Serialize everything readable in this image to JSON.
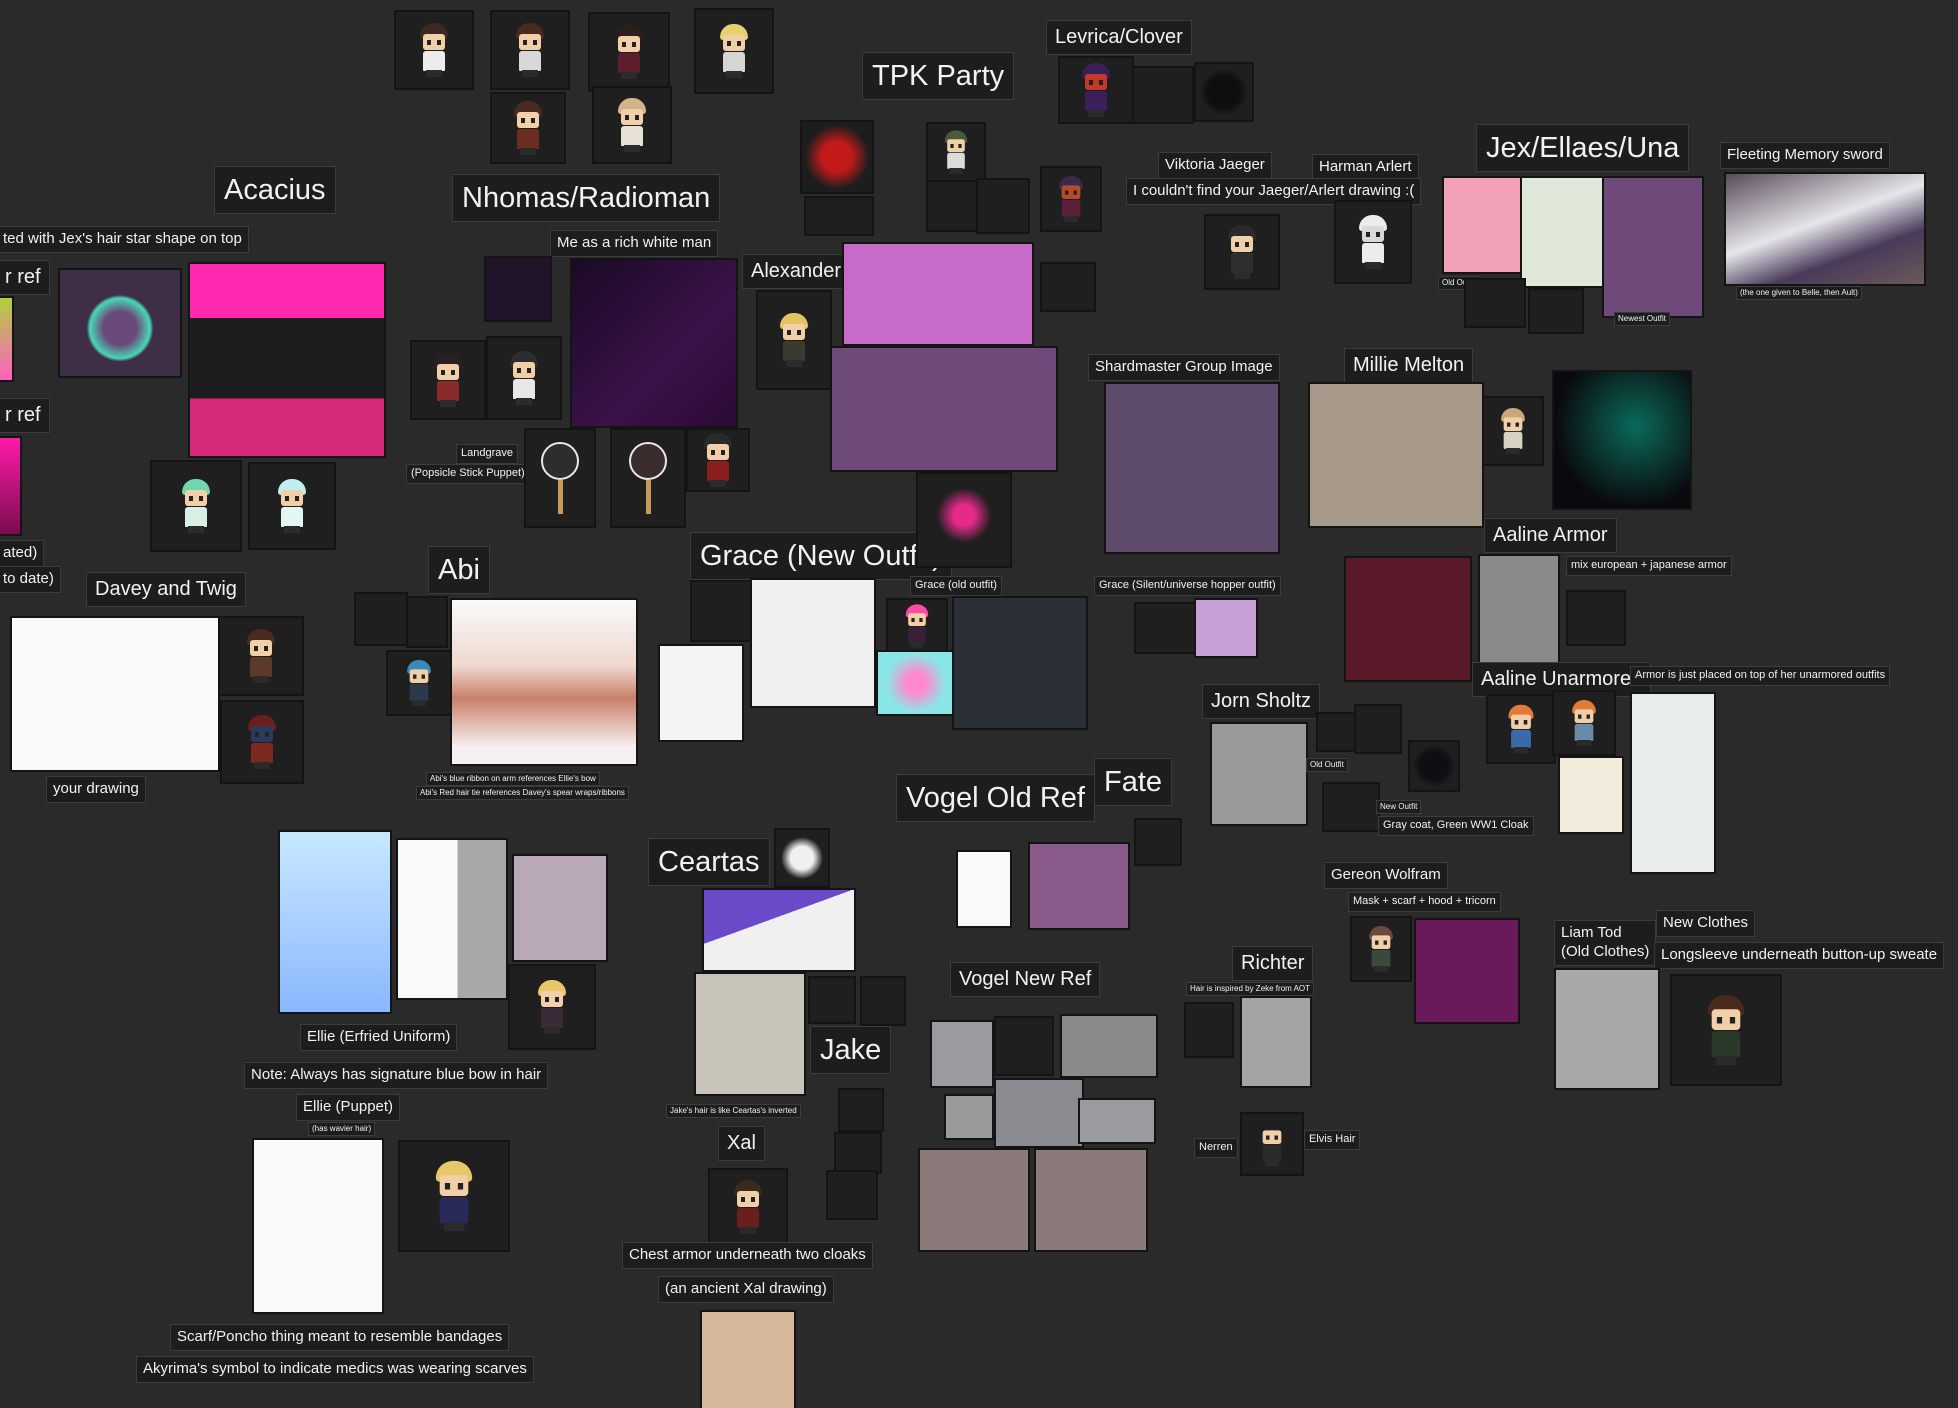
{
  "labels": [
    {
      "id": "acacius-title",
      "text": "Acacius"
    },
    {
      "id": "jex-hair-note",
      "text": "ted with Jex's hair star shape on top"
    },
    {
      "id": "ref-left-1",
      "text": "r ref"
    },
    {
      "id": "ref-left-2",
      "text": "r ref"
    },
    {
      "id": "ated-note",
      "text": "ated)"
    },
    {
      "id": "to-date-note",
      "text": "to date)"
    },
    {
      "id": "nhomas-title",
      "text": "Nhomas/Radioman"
    },
    {
      "id": "rich-white-man-note",
      "text": "Me as a rich white man"
    },
    {
      "id": "landgrave-note",
      "text": "Landgrave"
    },
    {
      "id": "popsicle-note",
      "text": "(Popsicle Stick Puppet)"
    },
    {
      "id": "tpk-title",
      "text": "TPK Party"
    },
    {
      "id": "levrica-title",
      "text": "Levrica/Clover"
    },
    {
      "id": "alexander-title",
      "text": "Alexander"
    },
    {
      "id": "viktoria-title",
      "text": "Viktoria Jaeger"
    },
    {
      "id": "harman-title",
      "text": "Harman Arlert"
    },
    {
      "id": "jaeger-arlert-note",
      "text": "I couldn't find your Jaeger/Arlert drawing :("
    },
    {
      "id": "jex-title",
      "text": "Jex/Ellaes/Una"
    },
    {
      "id": "jex-old-outfit",
      "text": "Old Outfit"
    },
    {
      "id": "jex-newest-outfit",
      "text": "Newest Outfit"
    },
    {
      "id": "fleeting-title",
      "text": "Fleeting Memory sword"
    },
    {
      "id": "fleeting-note",
      "text": "(the one given to Belle, then Ault)"
    },
    {
      "id": "shardmaster-title",
      "text": "Shardmaster Group Image"
    },
    {
      "id": "millie-title",
      "text": "Millie Melton"
    },
    {
      "id": "aaline-armor-title",
      "text": "Aaline Armor"
    },
    {
      "id": "aaline-armor-note",
      "text": "mix european + japanese armor"
    },
    {
      "id": "aaline-unarmored-title",
      "text": "Aaline Unarmored"
    },
    {
      "id": "aaline-unarmored-note",
      "text": "Armor is just placed on top of her unarmored outfits"
    },
    {
      "id": "grace-new-title",
      "text": "Grace (New Outfit)"
    },
    {
      "id": "grace-old-note",
      "text": "Grace (old outfit)"
    },
    {
      "id": "grace-silent-note",
      "text": "Grace (Silent/universe hopper outfit)"
    },
    {
      "id": "abi-title",
      "text": "Abi"
    },
    {
      "id": "abi-ribbon-note",
      "text": "Abi's blue ribbon on arm references Ellie's bow"
    },
    {
      "id": "abi-hairtie-note",
      "text": "Abi's Red hair tie references Davey's spear wraps/ribbons"
    },
    {
      "id": "davey-title",
      "text": "Davey and Twig"
    },
    {
      "id": "your-drawing-note",
      "text": "your drawing"
    },
    {
      "id": "jorn-title",
      "text": "Jorn Sholtz"
    },
    {
      "id": "jorn-old-outfit",
      "text": "Old Outfit"
    },
    {
      "id": "jorn-new-outfit",
      "text": "New Outfit"
    },
    {
      "id": "jorn-coat-note",
      "text": "Gray coat, Green WW1 Cloak"
    },
    {
      "id": "vogel-old-title",
      "text": "Vogel Old Ref"
    },
    {
      "id": "fate-title",
      "text": "Fate"
    },
    {
      "id": "ceartas-title",
      "text": "Ceartas"
    },
    {
      "id": "jake-title",
      "text": "Jake"
    },
    {
      "id": "jake-hair-note",
      "text": "Jake's hair is like Ceartas's inverted"
    },
    {
      "id": "xal-title",
      "text": "Xal"
    },
    {
      "id": "xal-armor-note",
      "text": "Chest armor underneath two cloaks"
    },
    {
      "id": "xal-ancient-note",
      "text": "(an ancient Xal drawing)"
    },
    {
      "id": "vogel-new-title",
      "text": "Vogel New Ref"
    },
    {
      "id": "gereon-title",
      "text": "Gereon Wolfram"
    },
    {
      "id": "gereon-note",
      "text": "Mask + scarf + hood + tricorn"
    },
    {
      "id": "richter-title",
      "text": "Richter"
    },
    {
      "id": "richter-note",
      "text": "Hair is inspired by Zeke from AOT"
    },
    {
      "id": "nerren-note",
      "text": "Nerren"
    },
    {
      "id": "elvis-note",
      "text": "Elvis Hair"
    },
    {
      "id": "liam-title",
      "text": "Liam Tod\n(Old Clothes)"
    },
    {
      "id": "new-clothes-title",
      "text": "New Clothes"
    },
    {
      "id": "longsleeve-note",
      "text": "Longsleeve underneath button-up sweate"
    },
    {
      "id": "ellie-erfried-title",
      "text": "Ellie (Erfried Uniform)"
    },
    {
      "id": "ellie-bow-note",
      "text": "Note: Always has signature blue bow in hair"
    },
    {
      "id": "ellie-puppet-title",
      "text": "Ellie (Puppet)"
    },
    {
      "id": "ellie-wavier-note",
      "text": "(has wavier hair)"
    },
    {
      "id": "scarf-note",
      "text": "Scarf/Poncho thing meant to resemble bandages"
    },
    {
      "id": "akyrima-note",
      "text": "Akyrima's symbol to indicate medics was wearing scarves"
    }
  ],
  "palette": {
    "board_background": "#2a2a2a",
    "label_background": "#1d1d1d",
    "label_text": "#f2f2f2",
    "magenta": "#e51aa8",
    "purple": "#6e4a7a"
  }
}
